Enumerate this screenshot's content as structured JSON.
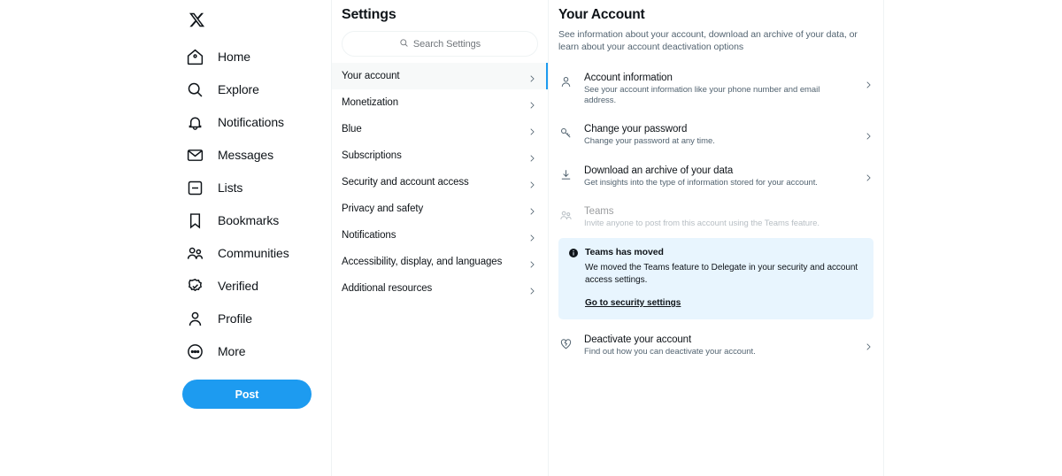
{
  "brand": {
    "logo": "x-logo",
    "accent": "#1d9bf0"
  },
  "sidebar": {
    "items": [
      {
        "label": "Home",
        "icon": "home-icon"
      },
      {
        "label": "Explore",
        "icon": "search-icon"
      },
      {
        "label": "Notifications",
        "icon": "bell-icon"
      },
      {
        "label": "Messages",
        "icon": "envelope-icon"
      },
      {
        "label": "Lists",
        "icon": "lists-icon"
      },
      {
        "label": "Bookmarks",
        "icon": "bookmark-icon"
      },
      {
        "label": "Communities",
        "icon": "communities-icon"
      },
      {
        "label": "Verified",
        "icon": "verified-badge-icon"
      },
      {
        "label": "Profile",
        "icon": "person-icon"
      },
      {
        "label": "More",
        "icon": "more-circle-icon"
      }
    ],
    "post_button": "Post"
  },
  "settings": {
    "title": "Settings",
    "search": {
      "placeholder": "Search Settings",
      "icon": "search-icon"
    },
    "items": [
      {
        "label": "Your account",
        "active": true
      },
      {
        "label": "Monetization",
        "active": false
      },
      {
        "label": "Blue",
        "active": false
      },
      {
        "label": "Subscriptions",
        "active": false
      },
      {
        "label": "Security and account access",
        "active": false
      },
      {
        "label": "Privacy and safety",
        "active": false
      },
      {
        "label": "Notifications",
        "active": false
      },
      {
        "label": "Accessibility, display, and languages",
        "active": false
      },
      {
        "label": "Additional resources",
        "active": false
      }
    ]
  },
  "main": {
    "title": "Your Account",
    "description": "See information about your account, download an archive of your data, or learn about your account deactivation options",
    "options": [
      {
        "title": "Account information",
        "subtitle": "See your account information like your phone number and email address.",
        "icon": "person-icon",
        "disabled": false,
        "chevron": true
      },
      {
        "title": "Change your password",
        "subtitle": "Change your password at any time.",
        "icon": "key-icon",
        "disabled": false,
        "chevron": true
      },
      {
        "title": "Download an archive of your data",
        "subtitle": "Get insights into the type of information stored for your account.",
        "icon": "download-icon",
        "disabled": false,
        "chevron": true
      },
      {
        "title": "Teams",
        "subtitle": "Invite anyone to post from this account using the Teams feature.",
        "icon": "communities-icon",
        "disabled": true,
        "chevron": false
      }
    ],
    "alert": {
      "icon": "info-icon",
      "title": "Teams has moved",
      "body": "We moved the Teams feature to Delegate in your security and account access settings.",
      "link": "Go to security settings",
      "background": "#e8f5fe"
    },
    "deactivate": {
      "title": "Deactivate your account",
      "subtitle": "Find out how you can deactivate your account.",
      "icon": "broken-heart-icon",
      "chevron": true
    }
  }
}
